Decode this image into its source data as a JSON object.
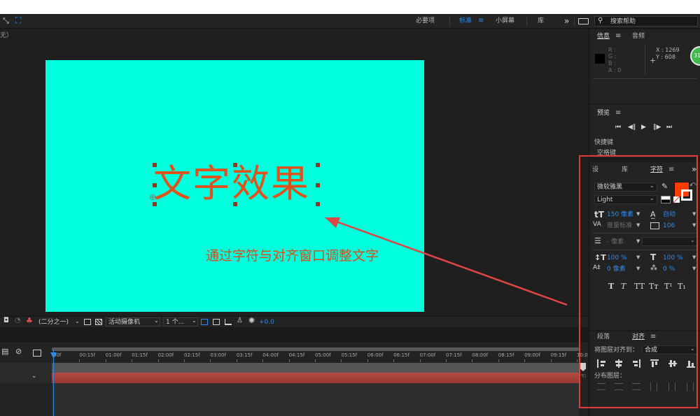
{
  "top_bar": {
    "workspaces": [
      "必要项",
      "标准",
      "小屏幕",
      "库"
    ],
    "active_workspace": "标准",
    "menu_symbol": "≡",
    "more_symbol": "»",
    "search_placeholder": "搜索帮助"
  },
  "comp_panel": {
    "breadcrumb": "无）",
    "canvas_color": "#00ffdd",
    "title_text": "文字效果",
    "title_color": "#e0521b",
    "annotation": "通过字符与对齐窗口调整文字",
    "annotation_color": "#e04a16"
  },
  "viewer_toolbar": {
    "resolution": "(二分之一)",
    "camera": "活动摄像机",
    "views": "1 个...",
    "exposure": "+0.0"
  },
  "info_panel": {
    "tabs": [
      "信息",
      "音频"
    ],
    "menu_symbol": "≡",
    "rgba_labels": [
      "R :",
      "G :",
      "B :",
      "A : 0"
    ],
    "x_readout": "X : 1269",
    "y_readout": "Y : 608",
    "badge": "31"
  },
  "preview_panel": {
    "title": "预览",
    "menu_symbol": "≡",
    "shortcut_label": "快捷键",
    "shortcut_value": "空格键",
    "controls": [
      "first-frame",
      "prev-frame",
      "play",
      "next-frame",
      "last-frame"
    ]
  },
  "character_panel": {
    "tabs": [
      "预设",
      "库",
      "字符"
    ],
    "tab_visible_text": [
      "设",
      "库",
      "字符"
    ],
    "active_tab": "字符",
    "menu_symbol": "≡",
    "more_symbol": "»",
    "font_family": "微软雅黑",
    "font_style": "Light",
    "fill_color": "#ff3d00",
    "font_size": "150 像素",
    "leading": "自动",
    "kerning": "度量标准",
    "tracking": "106",
    "stroke_width": "- 像素",
    "vertical_scale": "100 %",
    "horizontal_scale": "100 %",
    "baseline_shift": "0 像素",
    "tsume": "0 %",
    "style_buttons": [
      "T",
      "T",
      "TT",
      "Tт",
      "T¹",
      "T₁"
    ]
  },
  "align_panel": {
    "tabs": [
      "段落",
      "对齐"
    ],
    "active_tab": "对齐",
    "menu_symbol": "≡",
    "align_layers_label": "将图层对齐到：",
    "align_target": "合成",
    "distribute_label": "分布图层："
  },
  "timeline": {
    "ruler_labels": [
      "00f",
      "00:15f",
      "01:00f",
      "01:15f",
      "02:00f",
      "02:15f",
      "03:00f",
      "03:15f",
      "04:00f",
      "04:15f",
      "05:00f",
      "05:15f",
      "06:00f",
      "06:15f",
      "07:00f",
      "07:15f",
      "08:00f",
      "08:15f",
      "09:00f",
      "09:15f",
      "10:0"
    ],
    "layer_bar_color": "#a83a34"
  },
  "colors": {
    "highlight_box": "#e03c3c",
    "arrow": "#e04545",
    "accent": "#2d8ceb",
    "panel": "#232323",
    "background": "#1d1d1d"
  }
}
